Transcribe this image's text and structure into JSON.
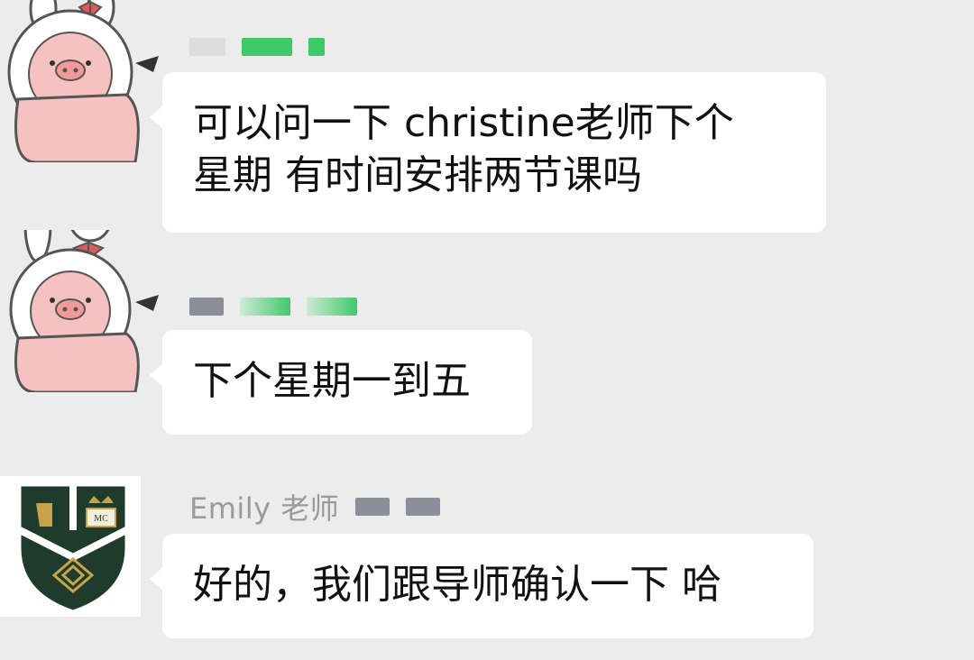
{
  "messages": [
    {
      "sender": "",
      "avatar": "bunny-pig-avatar-icon",
      "lines": [
        "可以问一下 christine老师下个",
        "星期 有时间安排两节课吗"
      ]
    },
    {
      "sender": "",
      "avatar": "bunny-pig-avatar-icon",
      "lines": [
        "下个星期一到五"
      ]
    },
    {
      "sender": "Emily 老师",
      "avatar": "school-crest-avatar-icon",
      "lines": [
        "好的，我们跟导师确认一下 哈"
      ]
    }
  ],
  "colors": {
    "background": "#ececec",
    "bubble": "#ffffff",
    "text": "#111111",
    "sender_name": "#9a9a9a",
    "redaction_green": "#2fc25b",
    "redaction_gray": "#8a8f99",
    "crest_green": "#1f3b2c",
    "crest_gold": "#c9a349"
  }
}
